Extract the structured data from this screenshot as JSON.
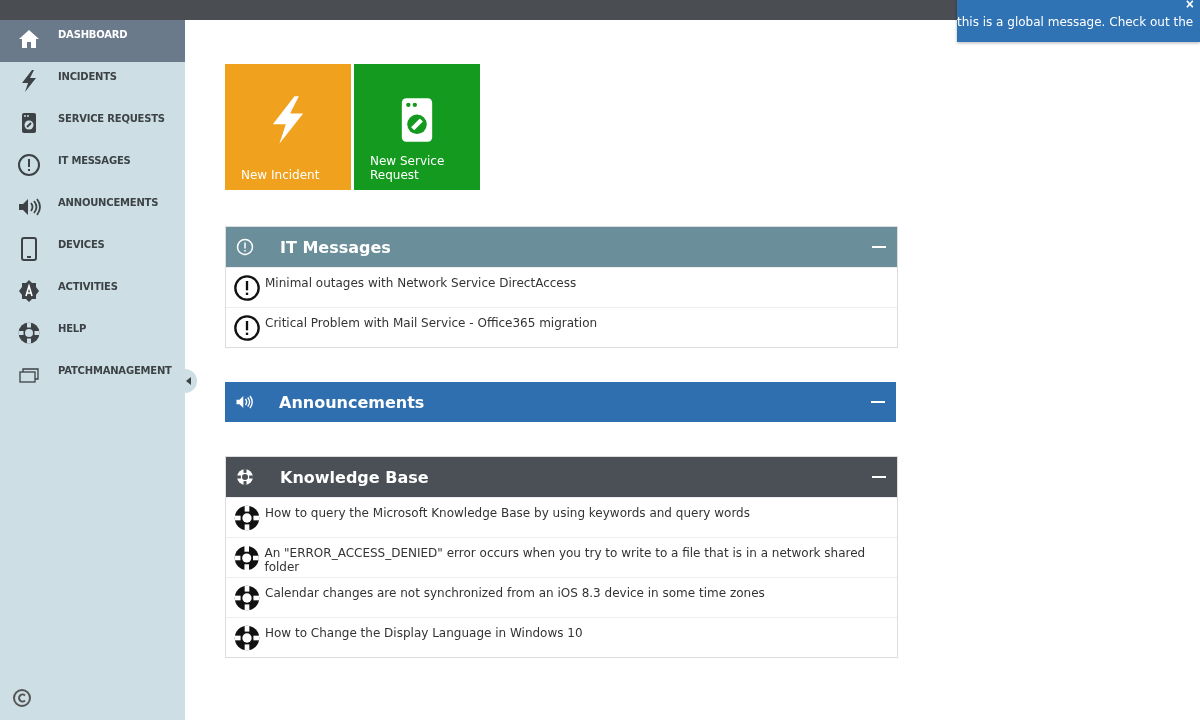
{
  "toast": {
    "close": "×",
    "text": "this is a global message. Check out the"
  },
  "sidebar": {
    "items": [
      {
        "label": "DASHBOARD",
        "kind": "home",
        "selected": true
      },
      {
        "label": "INCIDENTS",
        "kind": "bolt",
        "selected": false
      },
      {
        "label": "SERVICE REQUESTS",
        "kind": "washer",
        "selected": false
      },
      {
        "label": "IT MESSAGES",
        "kind": "alert",
        "selected": false
      },
      {
        "label": "ANNOUNCEMENTS",
        "kind": "speaker",
        "selected": false
      },
      {
        "label": "DEVICES",
        "kind": "tablet",
        "selected": false
      },
      {
        "label": "ACTIVITIES",
        "kind": "gear",
        "selected": false
      },
      {
        "label": "HELP",
        "kind": "lifebuoy",
        "selected": false
      },
      {
        "label": "PATCHMANAGEMENT",
        "kind": "windows",
        "selected": false
      }
    ]
  },
  "tiles": [
    {
      "label": "New Incident",
      "kind": "bolt",
      "color": "#f0a11d"
    },
    {
      "label": "New Service Request",
      "kind": "washer",
      "color": "#149a1f"
    }
  ],
  "panels": [
    {
      "title": "IT Messages",
      "kind": "alert",
      "color": "#6a8e9a",
      "expanded": true,
      "items": [
        "Minimal outages with Network Service DirectAccess",
        "Critical Problem with Mail Service - Office365 migration"
      ]
    },
    {
      "title": "Announcements",
      "kind": "speaker",
      "color": "#2f6fb0",
      "expanded": true
    },
    {
      "title": "Knowledge Base",
      "kind": "lifebuoy",
      "color": "#4a5055",
      "expanded": true,
      "items": [
        "How to query the Microsoft Knowledge Base by using keywords and query words",
        "An \"ERROR_ACCESS_DENIED\" error occurs when you try to write to a file that is in a network shared folder",
        "Calendar changes are not synchronized from an iOS 8.3 device in some time zones",
        "How to Change the Display Language in Windows 10"
      ]
    }
  ]
}
